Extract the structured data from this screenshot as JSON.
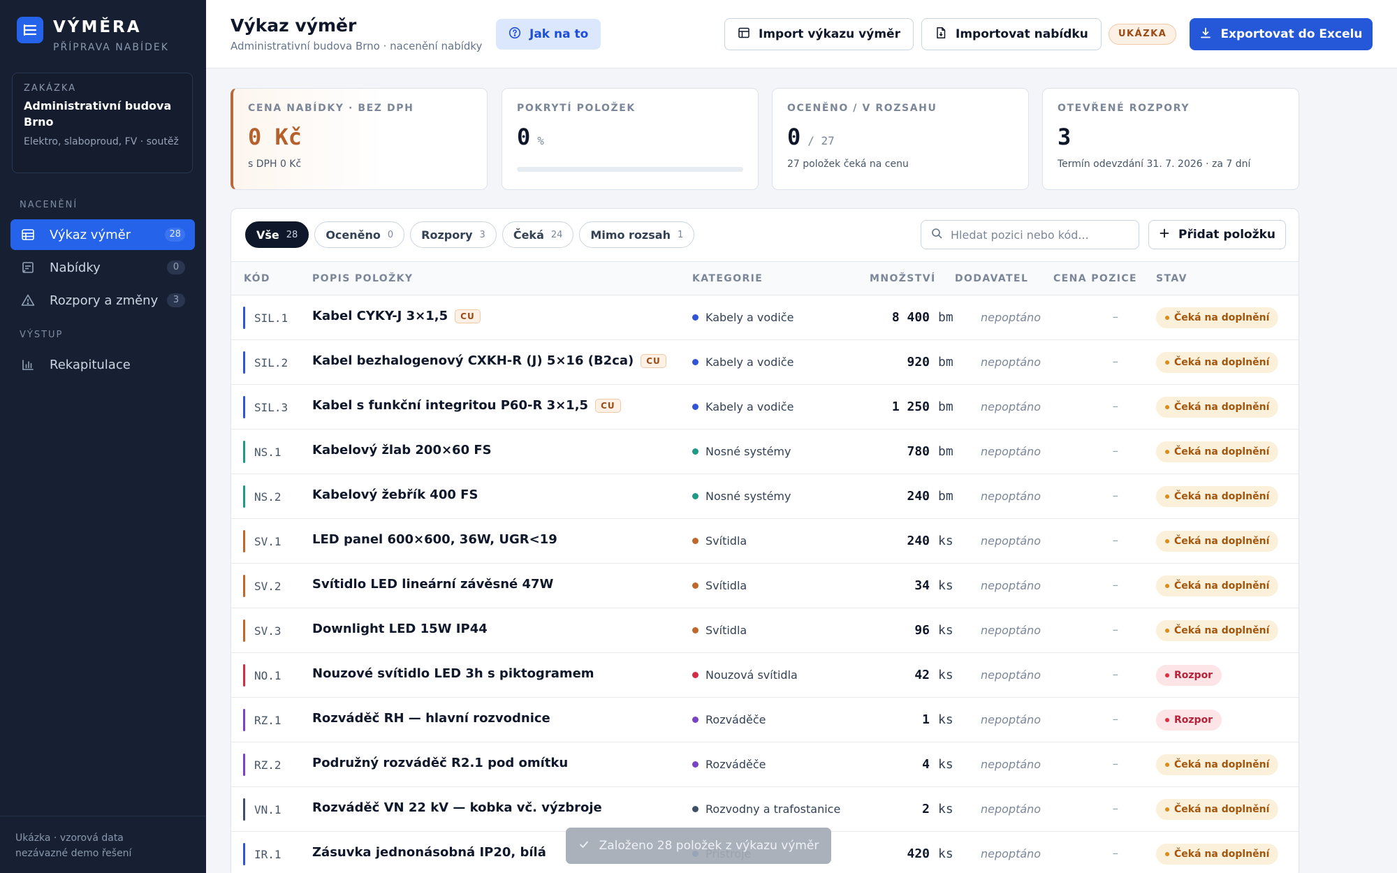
{
  "sidebar": {
    "brand_title": "VÝMĚRA",
    "brand_subtitle": "PŘÍPRAVA NABÍDEK",
    "project": {
      "label": "ZAKÁZKA",
      "name": "Administrativní budova Brno",
      "description": "Elektro, slaboproud, FV · soutěž"
    },
    "section_pricing": "NACENĚNÍ",
    "section_output": "VÝSTUP",
    "items": [
      {
        "label": "Výkaz výměr",
        "badge": "28",
        "icon": "table-icon"
      },
      {
        "label": "Nabídky",
        "badge": "0",
        "icon": "offer-icon"
      },
      {
        "label": "Rozpory a změny",
        "badge": "3",
        "icon": "warning-icon"
      },
      {
        "label": "Rekapitulace",
        "icon": "bar-chart-icon"
      }
    ],
    "footer_line1": "Ukázka · vzorová data",
    "footer_line2": "nezávazné demo řešení"
  },
  "header": {
    "title": "Výkaz výměr",
    "subtitle": "Administrativní budova Brno · nacenění nabídky",
    "help_label": "Jak na to",
    "import_bq_label": "Import výkazu výměr",
    "import_offer_label": "Importovat nabídku",
    "demo_badge": "UKÁZKA",
    "export_label": "Exportovat do Excelu"
  },
  "kpis": {
    "price": {
      "label": "CENA NABÍDKY · BEZ DPH",
      "value": "0 Kč",
      "note": "s DPH 0 Kč"
    },
    "coverage": {
      "label": "POKRYTÍ POLOŽEK",
      "value": "0",
      "unit": "%",
      "progress": 0
    },
    "priced": {
      "label": "OCENĚNO / V ROZSAHU",
      "value": "0",
      "unit": "/ 27",
      "note": "27 položek čeká na cenu"
    },
    "conflicts": {
      "label": "OTEVŘENÉ ROZPORY",
      "value": "3",
      "note": "Termín odevzdání 31. 7. 2026 · za 7 dní"
    }
  },
  "filters": [
    {
      "label": "Vše",
      "count": "28"
    },
    {
      "label": "Oceněno",
      "count": "0"
    },
    {
      "label": "Rozpory",
      "count": "3"
    },
    {
      "label": "Čeká",
      "count": "24"
    },
    {
      "label": "Mimo rozsah",
      "count": "1"
    }
  ],
  "search": {
    "placeholder": "Hledat pozici nebo kód..."
  },
  "add_item_label": "Přidat položku",
  "table": {
    "columns": {
      "code": "KÓD",
      "description": "POPIS POLOŽKY",
      "category": "KATEGORIE",
      "quantity": "MNOŽSTVÍ",
      "supplier": "DODAVATEL",
      "price": "CENA POZICE",
      "status": "STAV"
    },
    "rows": [
      {
        "code": "SIL.1",
        "description": "Kabel CYKY-J 3×1,5",
        "tag": "CU",
        "category": "Kabely a vodiče",
        "color": "#2f55d4",
        "quantity": "8 400",
        "unit": "bm",
        "supplier": "nepoptáno",
        "price": "–",
        "status": "Čeká na doplnění",
        "status_type": "wait"
      },
      {
        "code": "SIL.2",
        "description": "Kabel bezhalogenový CXKH-R (J) 5×16 (B2ca)",
        "tag": "CU",
        "category": "Kabely a vodiče",
        "color": "#2f55d4",
        "quantity": "920",
        "unit": "bm",
        "supplier": "nepoptáno",
        "price": "–",
        "status": "Čeká na doplnění",
        "status_type": "wait"
      },
      {
        "code": "SIL.3",
        "description": "Kabel s funkční integritou P60-R 3×1,5",
        "tag": "CU",
        "category": "Kabely a vodiče",
        "color": "#2f55d4",
        "quantity": "1 250",
        "unit": "bm",
        "supplier": "nepoptáno",
        "price": "–",
        "status": "Čeká na doplnění",
        "status_type": "wait"
      },
      {
        "code": "NS.1",
        "description": "Kabelový žlab 200×60 FS",
        "tag": "",
        "category": "Nosné systémy",
        "color": "#1f9a85",
        "quantity": "780",
        "unit": "bm",
        "supplier": "nepoptáno",
        "price": "–",
        "status": "Čeká na doplnění",
        "status_type": "wait"
      },
      {
        "code": "NS.2",
        "description": "Kabelový žebřík 400 FS",
        "tag": "",
        "category": "Nosné systémy",
        "color": "#1f9a85",
        "quantity": "240",
        "unit": "bm",
        "supplier": "nepoptáno",
        "price": "–",
        "status": "Čeká na doplnění",
        "status_type": "wait"
      },
      {
        "code": "SV.1",
        "description": "LED panel 600×600, 36W, UGR<19",
        "tag": "",
        "category": "Svítidla",
        "color": "#c0672c",
        "quantity": "240",
        "unit": "ks",
        "supplier": "nepoptáno",
        "price": "–",
        "status": "Čeká na doplnění",
        "status_type": "wait"
      },
      {
        "code": "SV.2",
        "description": "Svítidlo LED lineární závěsné 47W",
        "tag": "",
        "category": "Svítidla",
        "color": "#c0672c",
        "quantity": "34",
        "unit": "ks",
        "supplier": "nepoptáno",
        "price": "–",
        "status": "Čeká na doplnění",
        "status_type": "wait"
      },
      {
        "code": "SV.3",
        "description": "Downlight LED 15W IP44",
        "tag": "",
        "category": "Svítidla",
        "color": "#c0672c",
        "quantity": "96",
        "unit": "ks",
        "supplier": "nepoptáno",
        "price": "–",
        "status": "Čeká na doplnění",
        "status_type": "wait"
      },
      {
        "code": "NO.1",
        "description": "Nouzové svítidlo LED 3h s piktogramem",
        "tag": "",
        "category": "Nouzová svítidla",
        "color": "#d12d45",
        "quantity": "42",
        "unit": "ks",
        "supplier": "nepoptáno",
        "price": "–",
        "status": "Rozpor",
        "status_type": "conflict"
      },
      {
        "code": "RZ.1",
        "description": "Rozváděč RH — hlavní rozvodnice",
        "tag": "",
        "category": "Rozváděče",
        "color": "#7b43c4",
        "quantity": "1",
        "unit": "ks",
        "supplier": "nepoptáno",
        "price": "–",
        "status": "Rozpor",
        "status_type": "conflict"
      },
      {
        "code": "RZ.2",
        "description": "Podružný rozváděč R2.1 pod omítku",
        "tag": "",
        "category": "Rozváděče",
        "color": "#7b43c4",
        "quantity": "4",
        "unit": "ks",
        "supplier": "nepoptáno",
        "price": "–",
        "status": "Čeká na doplnění",
        "status_type": "wait"
      },
      {
        "code": "VN.1",
        "description": "Rozváděč VN 22 kV — kobka vč. výzbroje",
        "tag": "",
        "category": "Rozvodny a trafostanice",
        "color": "#3d5068",
        "quantity": "2",
        "unit": "ks",
        "supplier": "nepoptáno",
        "price": "–",
        "status": "Čeká na doplnění",
        "status_type": "wait"
      },
      {
        "code": "IR.1",
        "description": "Zásuvka jednonásobná IP20, bílá",
        "tag": "",
        "category": "Přístroje",
        "color": "#2f55d4",
        "quantity": "420",
        "unit": "ks",
        "supplier": "nepoptáno",
        "price": "–",
        "status": "Čeká na doplnění",
        "status_type": "wait"
      }
    ]
  },
  "toast": {
    "message": "Založeno 28 položek z výkazu výměr"
  }
}
